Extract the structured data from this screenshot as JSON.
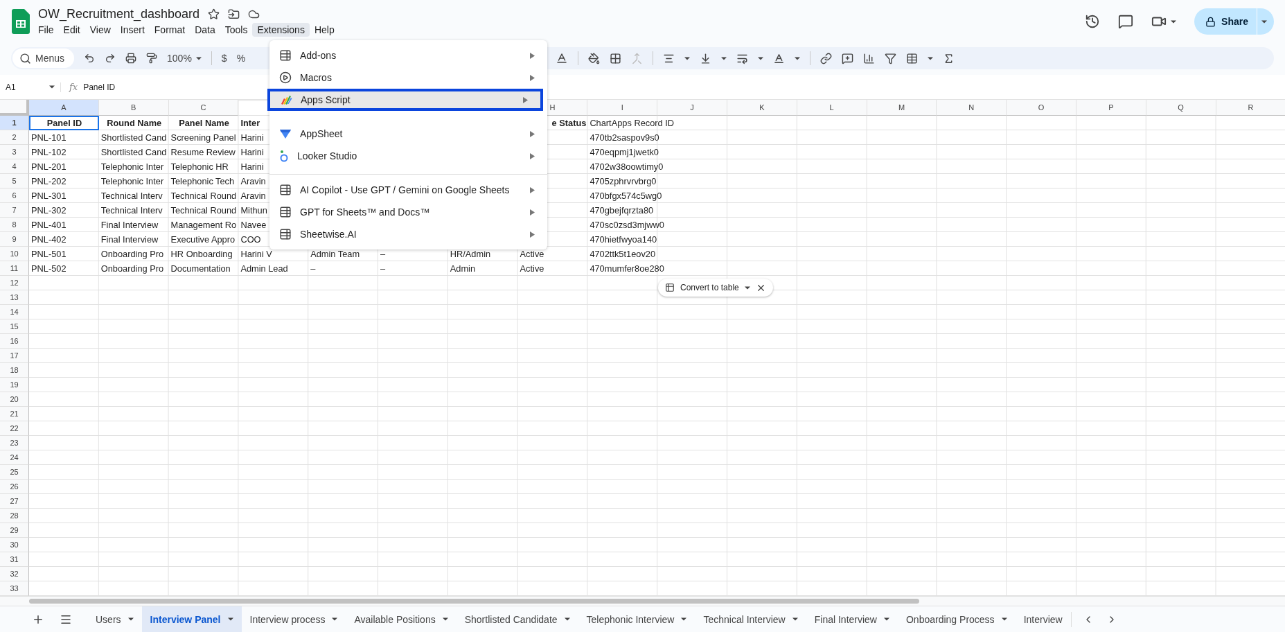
{
  "document": {
    "title": "OW_Recruitment_dashboard"
  },
  "menu_bar": [
    {
      "label": "File",
      "selected": false
    },
    {
      "label": "Edit",
      "selected": false
    },
    {
      "label": "View",
      "selected": false
    },
    {
      "label": "Insert",
      "selected": false
    },
    {
      "label": "Format",
      "selected": false
    },
    {
      "label": "Data",
      "selected": false
    },
    {
      "label": "Tools",
      "selected": false
    },
    {
      "label": "Extensions",
      "selected": true
    },
    {
      "label": "Help",
      "selected": false
    }
  ],
  "share_button": {
    "label": "Share"
  },
  "toolbar": {
    "search": {
      "placeholder": "Menus"
    },
    "zoom": "100%",
    "currency": "$",
    "percent": "%"
  },
  "formula_bar": {
    "cell": "A1",
    "fx": "fx",
    "value": "Panel ID"
  },
  "columns": [
    {
      "label": "A",
      "selected": true
    },
    {
      "label": "B",
      "selected": false
    },
    {
      "label": "C",
      "selected": false
    },
    null,
    null,
    null,
    null,
    {
      "label": "H",
      "selected": false
    },
    {
      "label": "I",
      "selected": false
    },
    {
      "label": "J",
      "selected": false
    },
    {
      "label": "K",
      "selected": false
    },
    {
      "label": "L",
      "selected": false
    },
    {
      "label": "M",
      "selected": false
    },
    {
      "label": "N",
      "selected": false
    },
    {
      "label": "O",
      "selected": false
    },
    {
      "label": "P",
      "selected": false
    },
    {
      "label": "Q",
      "selected": false
    },
    {
      "label": "R",
      "selected": false
    }
  ],
  "rows": [
    {
      "number": "1",
      "selected": true,
      "cells": [
        {
          "text": "Panel ID",
          "bold": true
        },
        {
          "text": "Round Name",
          "bold": true
        },
        {
          "text": "Panel Name",
          "bold": true
        },
        {
          "text": "Inter",
          "bold": true,
          "clipped_right": true
        },
        "",
        "",
        "",
        {
          "text": "e Status",
          "bold": true,
          "clipped_left": true
        },
        {
          "text": "ChartApps Record ID",
          "bold": false
        }
      ]
    },
    {
      "number": "2",
      "selected": false,
      "cells": [
        "PNL-101",
        "Shortlisted Cand",
        "Screening Panel",
        "Harini",
        "",
        "",
        "",
        "",
        "470tb2saspov9s0"
      ]
    },
    {
      "number": "3",
      "selected": false,
      "cells": [
        "PNL-102",
        "Shortlisted Cand",
        "Resume Review",
        "Harini",
        "",
        "",
        "",
        "",
        "470eqpmj1jwetk0"
      ]
    },
    {
      "number": "4",
      "selected": false,
      "cells": [
        "PNL-201",
        "Telephonic Inter",
        "Telephonic HR",
        "Harini",
        "",
        "",
        "",
        "",
        "4702w38oowtimy0"
      ]
    },
    {
      "number": "5",
      "selected": false,
      "cells": [
        "PNL-202",
        "Telephonic Inter",
        "Telephonic Tech",
        "Aravin",
        "",
        "",
        "",
        "",
        "4705zphrvrvbrg0"
      ]
    },
    {
      "number": "6",
      "selected": false,
      "cells": [
        "PNL-301",
        "Technical Interv",
        "Technical Round",
        "Aravin",
        "",
        "",
        "",
        "",
        "470bfgx574c5wg0"
      ]
    },
    {
      "number": "7",
      "selected": false,
      "cells": [
        "PNL-302",
        "Technical Interv",
        "Technical Round",
        "Mithun",
        "",
        "",
        "",
        "",
        "470gbejfqrzta80"
      ]
    },
    {
      "number": "8",
      "selected": false,
      "cells": [
        "PNL-401",
        "Final Interview",
        "Management Ro",
        "Navee",
        "",
        "",
        "",
        "",
        "470sc0zsd3mjww0"
      ]
    },
    {
      "number": "9",
      "selected": false,
      "cells": [
        "PNL-402",
        "Final Interview",
        "Executive Appro",
        "COO",
        "",
        "",
        "",
        "",
        "470hietfwyoa140"
      ]
    },
    {
      "number": "10",
      "selected": false,
      "cells": [
        "PNL-501",
        "Onboarding Pro",
        "HR Onboarding",
        "Harini V",
        "Admin Team",
        "–",
        "HR/Admin",
        "Active",
        "4702ttk5t1eov20"
      ]
    },
    {
      "number": "11",
      "selected": false,
      "cells": [
        "PNL-502",
        "Onboarding Pro",
        "Documentation",
        "Admin Lead",
        "–",
        "–",
        "Admin",
        "Active",
        "470mumfer8oe280"
      ]
    },
    {
      "number": "12",
      "selected": false,
      "cells": []
    },
    {
      "number": "13",
      "selected": false,
      "cells": []
    },
    {
      "number": "14",
      "selected": false,
      "cells": []
    },
    {
      "number": "15",
      "selected": false,
      "cells": []
    },
    {
      "number": "16",
      "selected": false,
      "cells": []
    },
    {
      "number": "17",
      "selected": false,
      "cells": []
    },
    {
      "number": "18",
      "selected": false,
      "cells": []
    },
    {
      "number": "19",
      "selected": false,
      "cells": []
    },
    {
      "number": "20",
      "selected": false,
      "cells": []
    },
    {
      "number": "21",
      "selected": false,
      "cells": []
    },
    {
      "number": "22",
      "selected": false,
      "cells": []
    },
    {
      "number": "23",
      "selected": false,
      "cells": []
    },
    {
      "number": "24",
      "selected": false,
      "cells": []
    },
    {
      "number": "25",
      "selected": false,
      "cells": []
    },
    {
      "number": "26",
      "selected": false,
      "cells": []
    },
    {
      "number": "27",
      "selected": false,
      "cells": []
    },
    {
      "number": "28",
      "selected": false,
      "cells": []
    },
    {
      "number": "29",
      "selected": false,
      "cells": []
    },
    {
      "number": "30",
      "selected": false,
      "cells": []
    },
    {
      "number": "31",
      "selected": false,
      "cells": []
    },
    {
      "number": "32",
      "selected": false,
      "cells": []
    },
    {
      "number": "33",
      "selected": false,
      "cells": []
    }
  ],
  "convert_to_table": {
    "label": "Convert to table"
  },
  "extensions_menu": [
    {
      "kind": "item",
      "label": "Add-ons",
      "highlighted": false
    },
    {
      "kind": "item",
      "label": "Macros",
      "highlighted": false
    },
    {
      "kind": "item",
      "label": "Apps Script",
      "highlighted": true
    },
    {
      "kind": "spacer"
    },
    {
      "kind": "item",
      "label": "AppSheet",
      "highlighted": false
    },
    {
      "kind": "item",
      "label": "Looker Studio",
      "highlighted": false
    },
    {
      "kind": "separator"
    },
    {
      "kind": "item",
      "label": "AI Copilot - Use GPT / Gemini on Google Sheets",
      "highlighted": false
    },
    {
      "kind": "item",
      "label": "GPT for Sheets™ and Docs™",
      "highlighted": false
    },
    {
      "kind": "item",
      "label": "Sheetwise.AI",
      "highlighted": false
    }
  ],
  "sheet_tabs": [
    {
      "label": "Users",
      "selected": false,
      "caret": true
    },
    {
      "label": "Interview Panel",
      "selected": true,
      "caret": true
    },
    {
      "label": "Interview process",
      "selected": false,
      "caret": true
    },
    {
      "label": "Available Positions",
      "selected": false,
      "caret": true
    },
    {
      "label": "Shortlisted Candidate",
      "selected": false,
      "caret": true
    },
    {
      "label": "Telephonic Interview",
      "selected": false,
      "caret": true
    },
    {
      "label": "Technical Interview",
      "selected": false,
      "caret": true
    },
    {
      "label": "Final Interview",
      "selected": false,
      "caret": true
    },
    {
      "label": "Onboarding Process",
      "selected": false,
      "caret": true
    },
    {
      "label": "Interview",
      "selected": false,
      "caret": false
    }
  ]
}
